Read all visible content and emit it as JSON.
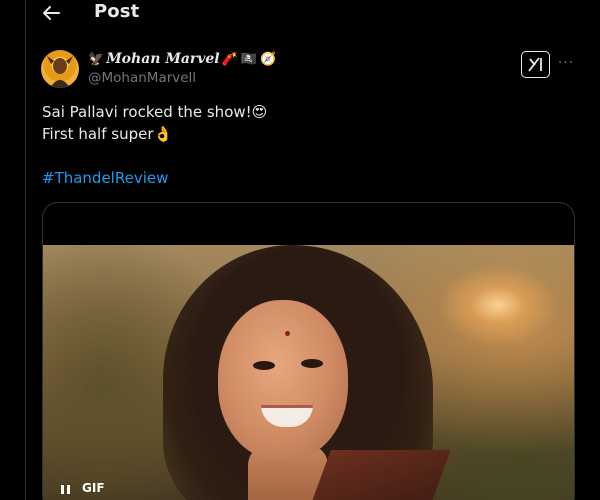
{
  "header": {
    "title": "Post",
    "back_icon": "arrow-left-icon"
  },
  "author": {
    "display_name": "Mohan Marvel",
    "handle": "@MohanMarvell",
    "name_emojis_before": [
      "🦅"
    ],
    "name_emojis_after": [
      "🧨",
      "🏴‍☠️",
      "🧭"
    ]
  },
  "actions": {
    "grok_icon": "grok-icon",
    "more_label": "···"
  },
  "tweet": {
    "lines": [
      "Sai Pallavi rocked the show!😍",
      "First half super👌"
    ],
    "hashtag": "#ThandelReview"
  },
  "media": {
    "type": "gif",
    "badge": "GIF",
    "playback": "playing"
  },
  "colors": {
    "background": "#000000",
    "text": "#e7e9ea",
    "muted": "#71767b",
    "link": "#1d9bf0",
    "border": "#2f3336"
  }
}
